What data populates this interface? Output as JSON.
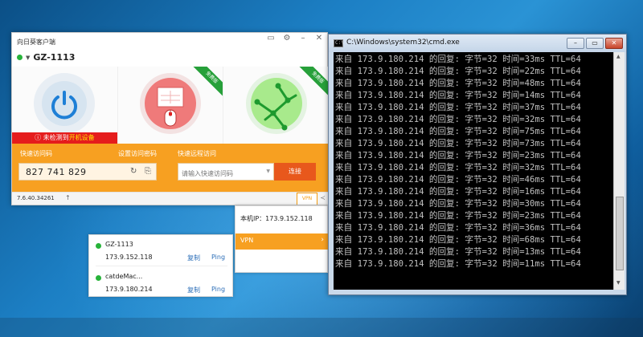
{
  "app": {
    "title": "向日葵客户端",
    "device_name": "GZ-1113",
    "tiles": {
      "remote_badge": "免费版",
      "network_badge": "免费版",
      "warning_prefix": "未检测到",
      "warning_highlight": "开机设备"
    },
    "quick_code_label": "快速访问码",
    "set_password_label": "设置访问密码",
    "remote_label": "快速远程访问",
    "access_code": "827 741 829",
    "remote_placeholder": "请输入快速访问码",
    "connect_button": "连接",
    "version": "7.6.40.34261",
    "vpn_tab": "VPN",
    "accent_color": "#f7a021"
  },
  "vpn_panel": {
    "local_ip": "本机IP：173.9.152.118",
    "vpn_label": "VPN"
  },
  "vpn_devices": [
    {
      "name": "GZ-1113",
      "ip": "173.9.152.118",
      "copy": "复制",
      "ping": "Ping"
    },
    {
      "name": "catdeMac...",
      "ip": "173.9.180.214",
      "copy": "复制",
      "ping": "Ping"
    }
  ],
  "cmd": {
    "title": "C:\\Windows\\system32\\cmd.exe",
    "lines": [
      "来自 173.9.180.214 的回复: 字节=32 时间=33ms TTL=64",
      "来自 173.9.180.214 的回复: 字节=32 时间=22ms TTL=64",
      "来自 173.9.180.214 的回复: 字节=32 时间=48ms TTL=64",
      "来自 173.9.180.214 的回复: 字节=32 时间=14ms TTL=64",
      "来自 173.9.180.214 的回复: 字节=32 时间=37ms TTL=64",
      "来自 173.9.180.214 的回复: 字节=32 时间=32ms TTL=64",
      "来自 173.9.180.214 的回复: 字节=32 时间=75ms TTL=64",
      "来自 173.9.180.214 的回复: 字节=32 时间=73ms TTL=64",
      "来自 173.9.180.214 的回复: 字节=32 时间=23ms TTL=64",
      "来自 173.9.180.214 的回复: 字节=32 时间=32ms TTL=64",
      "来自 173.9.180.214 的回复: 字节=32 时间=46ms TTL=64",
      "来自 173.9.180.214 的回复: 字节=32 时间=16ms TTL=64",
      "来自 173.9.180.214 的回复: 字节=32 时间=30ms TTL=64",
      "来自 173.9.180.214 的回复: 字节=32 时间=23ms TTL=64",
      "来自 173.9.180.214 的回复: 字节=32 时间=36ms TTL=64",
      "来自 173.9.180.214 的回复: 字节=32 时间=68ms TTL=64",
      "来自 173.9.180.214 的回复: 字节=32 时间=13ms TTL=64",
      "来自 173.9.180.214 的回复: 字节=32 时间=11ms TTL=64"
    ]
  }
}
